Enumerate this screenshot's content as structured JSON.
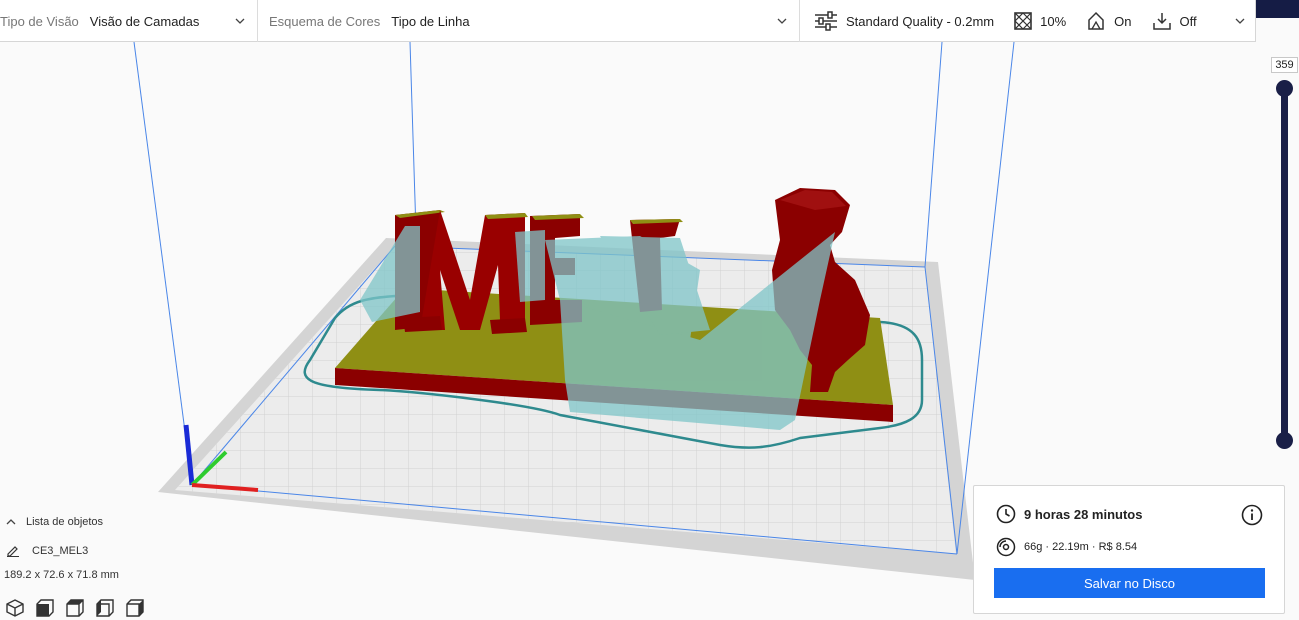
{
  "toolbar": {
    "view_type_label": "Tipo de Visão",
    "view_type_value": "Visão de Camadas",
    "color_scheme_label": "Esquema de Cores",
    "color_scheme_value": "Tipo de Linha",
    "quality_profile": "Standard Quality - 0.2mm",
    "infill": "10%",
    "support": "On",
    "adhesion": "Off"
  },
  "layer_slider": {
    "current_layer": "359"
  },
  "object_list": {
    "header": "Lista de objetos",
    "object_name": "CE3_MEL3",
    "dimensions": "189.2 x 72.6 x 71.8 mm"
  },
  "print_info": {
    "print_time": "9 horas 28 minutos",
    "material_summary": "66g · 22.19m · R$ 8.54",
    "save_button": "Salvar no Disco"
  },
  "icons": {
    "view_dropdown": "chevron-down-icon",
    "settings": "sliders-icon",
    "infill": "infill-pattern-icon",
    "support": "support-icon",
    "adhesion": "adhesion-icon",
    "time": "clock-icon",
    "material": "spool-icon",
    "info": "info-icon",
    "edit": "pencil-icon",
    "camera_views": [
      "3d-view-icon",
      "front-view-icon",
      "top-view-icon",
      "left-view-icon",
      "right-view-icon"
    ]
  },
  "colors": {
    "accent_blue": "#196ef0",
    "slider_navy": "#1a1f47",
    "wall_red": "#8b0000",
    "infill_olive": "#8f8f14",
    "support_teal": "#7fc5c8",
    "build_plate": "#e6e6e6"
  }
}
